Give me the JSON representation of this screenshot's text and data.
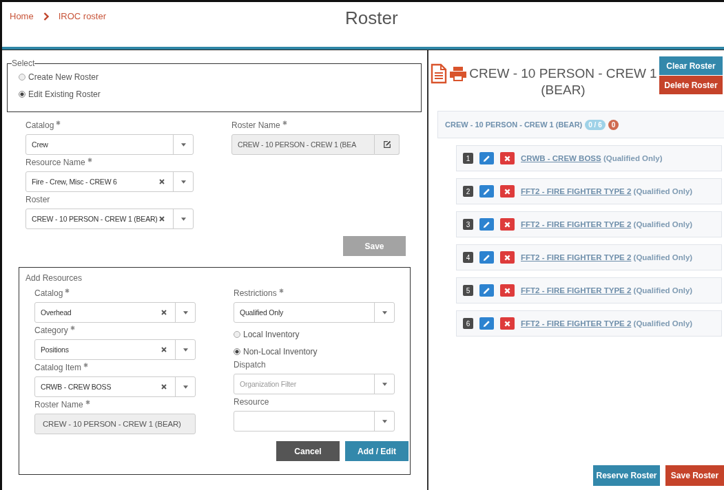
{
  "breadcrumb": [
    {
      "label": "Home"
    },
    {
      "label": "IROC roster"
    }
  ],
  "page_title": "Roster",
  "select_section": {
    "legend": "Select",
    "options": [
      {
        "label": "Create New Roster",
        "selected": false
      },
      {
        "label": "Edit Existing Roster",
        "selected": true
      }
    ]
  },
  "roster_form": {
    "left": [
      {
        "kind": "select",
        "label": "Catalog",
        "required": true,
        "value": "Crew",
        "clearable": false
      },
      {
        "kind": "select",
        "label": "Resource Name",
        "required": true,
        "value": "Fire - Crew, Misc - CREW 6",
        "clearable": true
      },
      {
        "kind": "select",
        "label": "Roster",
        "value": "CREW - 10 PERSON - CREW 1 (BEAR)",
        "clearable": true
      }
    ],
    "right": [
      {
        "kind": "readonly-edit",
        "label": "Roster Name",
        "required": true,
        "value": "CREW - 10 PERSON - CREW 1 (BEA"
      }
    ],
    "save_button": {
      "label": "Save",
      "disabled": true
    }
  },
  "add_resources": {
    "title": "Add Resources",
    "left": [
      {
        "kind": "select",
        "label": "Catalog",
        "required": true,
        "value": "Overhead",
        "clearable": true
      },
      {
        "kind": "select",
        "label": "Category",
        "required": true,
        "value": "Positions",
        "clearable": true
      },
      {
        "kind": "select",
        "label": "Catalog Item",
        "required": true,
        "value": "CRWB - CREW BOSS",
        "clearable": true
      },
      {
        "kind": "readonly",
        "label": "Roster Name",
        "required": true,
        "value": "CREW - 10 PERSON - CREW 1 (BEAR)"
      }
    ],
    "right": [
      {
        "kind": "select",
        "label": "Restrictions",
        "required": true,
        "value": "Qualified Only",
        "clearable": false
      },
      {
        "kind": "radio",
        "label": "Local Inventory",
        "selected": false
      },
      {
        "kind": "radio",
        "label": "Non-Local Inventory",
        "selected": true
      },
      {
        "kind": "select",
        "label": "Dispatch",
        "placeholder": "Organization Filter",
        "clearable": false
      },
      {
        "kind": "select",
        "label": "Resource",
        "clearable": false
      }
    ],
    "buttons": [
      {
        "label": "Cancel",
        "kind": "secondary"
      },
      {
        "label": "Add / Edit",
        "kind": "primary"
      }
    ]
  },
  "roster": {
    "title": "CREW - 10 PERSON - CREW 1 (BEAR)",
    "buttons": [
      {
        "label": "Clear Roster",
        "kind": "primary"
      },
      {
        "label": "Delete Roster",
        "kind": "danger"
      }
    ],
    "group": {
      "name": "CREW - 10 PERSON - CREW 1 (BEAR)",
      "count_badge": "0 / 6",
      "alert_badge": "0"
    },
    "positions": [
      {
        "number": "1",
        "position": "CRWB - CREW BOSS",
        "restriction": "(Qualified Only)"
      },
      {
        "number": "2",
        "position": "FFT2 - FIRE FIGHTER TYPE 2",
        "restriction": "(Qualified Only)"
      },
      {
        "number": "3",
        "position": "FFT2 - FIRE FIGHTER TYPE 2",
        "restriction": "(Qualified Only)"
      },
      {
        "number": "4",
        "position": "FFT2 - FIRE FIGHTER TYPE 2",
        "restriction": "(Qualified Only)"
      },
      {
        "number": "5",
        "position": "FFT2 - FIRE FIGHTER TYPE 2",
        "restriction": "(Qualified Only)"
      },
      {
        "number": "6",
        "position": "FFT2 - FIRE FIGHTER TYPE 2",
        "restriction": "(Qualified Only)"
      }
    ],
    "footer_buttons": [
      {
        "label": "Reserve Roster",
        "kind": "primary"
      },
      {
        "label": "Save Roster",
        "kind": "danger"
      }
    ]
  }
}
